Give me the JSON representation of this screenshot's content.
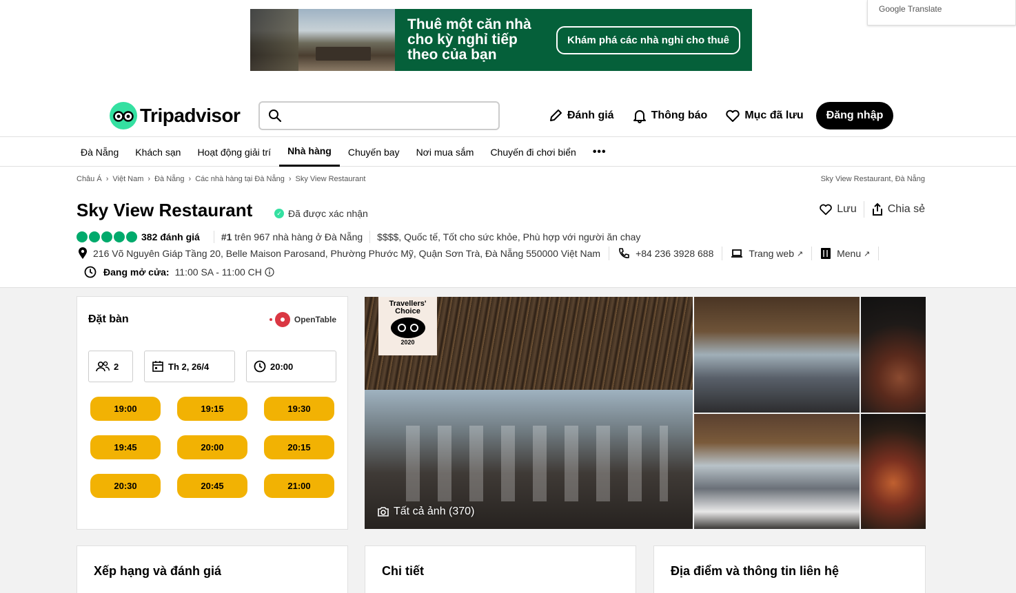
{
  "ad": {
    "headline": "Thuê một căn nhà cho kỳ nghỉ tiếp theo của bạn",
    "cta": "Khám phá các nhà nghỉ cho thuê"
  },
  "google_translate": {
    "label": "Google Translate"
  },
  "header": {
    "logo_text": "Tripadvisor",
    "search_placeholder": "",
    "actions": {
      "review": "Đánh giá",
      "notifications": "Thông báo",
      "saved": "Mục đã lưu",
      "login": "Đăng nhập"
    }
  },
  "nav": {
    "items": [
      "Đà Nẵng",
      "Khách sạn",
      "Hoạt động giải trí",
      "Nhà hàng",
      "Chuyến bay",
      "Nơi mua sắm",
      "Chuyến đi chơi biển"
    ],
    "active": "Nhà hàng",
    "more": "•••"
  },
  "breadcrumb": {
    "items": [
      "Châu Á",
      "Việt Nam",
      "Đà Nẵng",
      "Các nhà hàng tại Đà Nẵng",
      "Sky View Restaurant"
    ],
    "right": "Sky View Restaurant, Đà Nẵng"
  },
  "restaurant": {
    "name": "Sky View Restaurant",
    "verified": "Đã được xác nhận",
    "save": "Lưu",
    "share": "Chia sẻ",
    "rating": 5,
    "reviews": "382 đánh giá",
    "rank_prefix": "#1",
    "rank_text": "trên 967 nhà hàng ở Đà Nẵng",
    "tags": "$$$$, Quốc tế, Tốt cho sức khỏe, Phù hợp với người ăn chay",
    "address": "216 Võ Nguyên Giáp Tầng 20, Belle Maison Parosand, Phường Phước Mỹ, Quận Sơn Trà, Đà Nẵng 550000 Việt Nam",
    "phone": "+84 236 3928 688",
    "website": "Trang web",
    "menu": "Menu",
    "open_status": "Đang mở cửa:",
    "hours": "11:00 SA - 11:00 CH"
  },
  "booking": {
    "title": "Đặt bàn",
    "provider": "OpenTable",
    "party_size": "2",
    "date": "Th 2, 26/4",
    "time": "20:00",
    "slots": [
      "19:00",
      "19:15",
      "19:30",
      "19:45",
      "20:00",
      "20:15",
      "20:30",
      "20:45",
      "21:00"
    ]
  },
  "photos": {
    "badge_title": "Travellers' Choice",
    "badge_year": "2020",
    "all_photos": "Tất cả ảnh (370)"
  },
  "cards": {
    "ratings": "Xếp hạng và đánh giá",
    "details": "Chi tiết",
    "location": "Địa điểm và thông tin liên hệ"
  }
}
